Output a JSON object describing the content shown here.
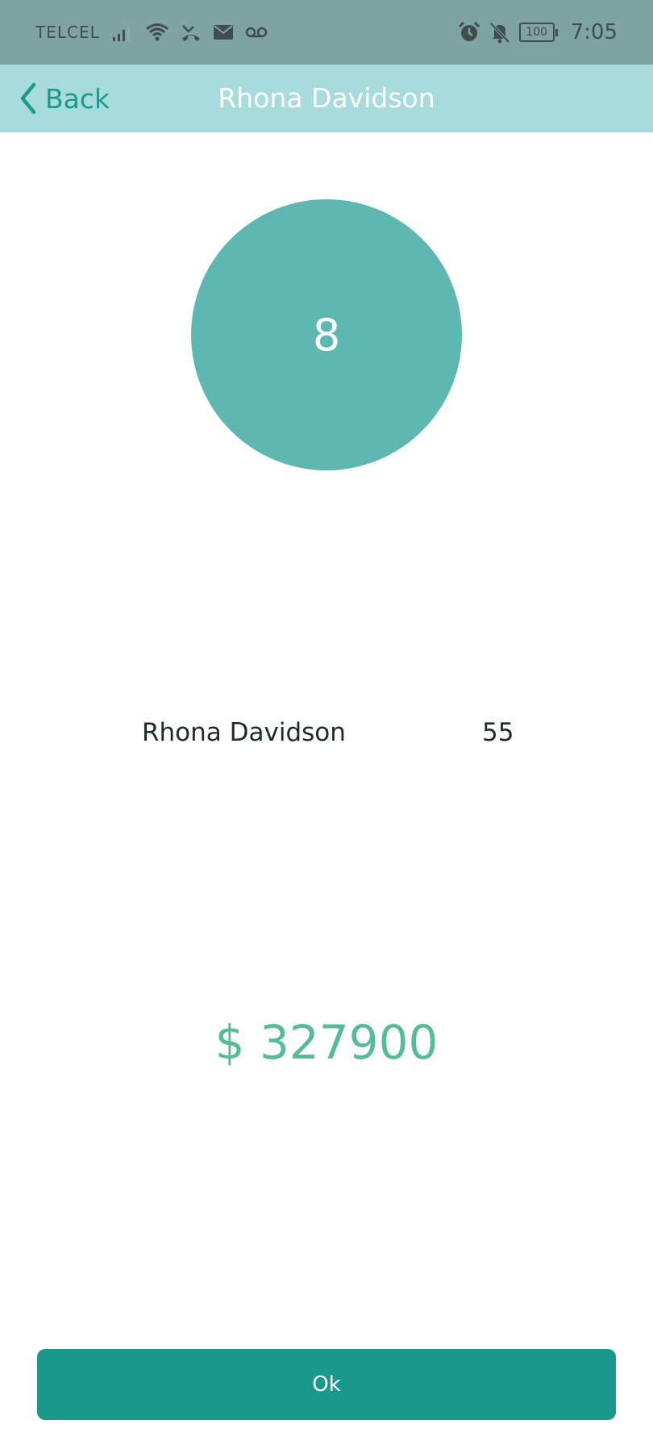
{
  "status_bar": {
    "carrier": "TELCEL",
    "battery_level": "100",
    "time": "7:05",
    "icons": [
      "signal-icon",
      "wifi-icon",
      "missed-call-icon",
      "mail-icon",
      "voicemail-icon",
      "alarm-icon",
      "bell-off-icon",
      "battery-icon"
    ]
  },
  "nav": {
    "back_label": "Back",
    "title": "Rhona Davidson"
  },
  "summary": {
    "count": "8",
    "name": "Rhona Davidson",
    "age": "55",
    "amount": "$ 327900"
  },
  "actions": {
    "ok_label": "Ok"
  },
  "colors": {
    "status_bar": "#7fa3a2",
    "nav_bar": "#a8dcdc",
    "accent": "#1a988c",
    "circle": "#5eb7b1",
    "amount": "#55bb98"
  }
}
